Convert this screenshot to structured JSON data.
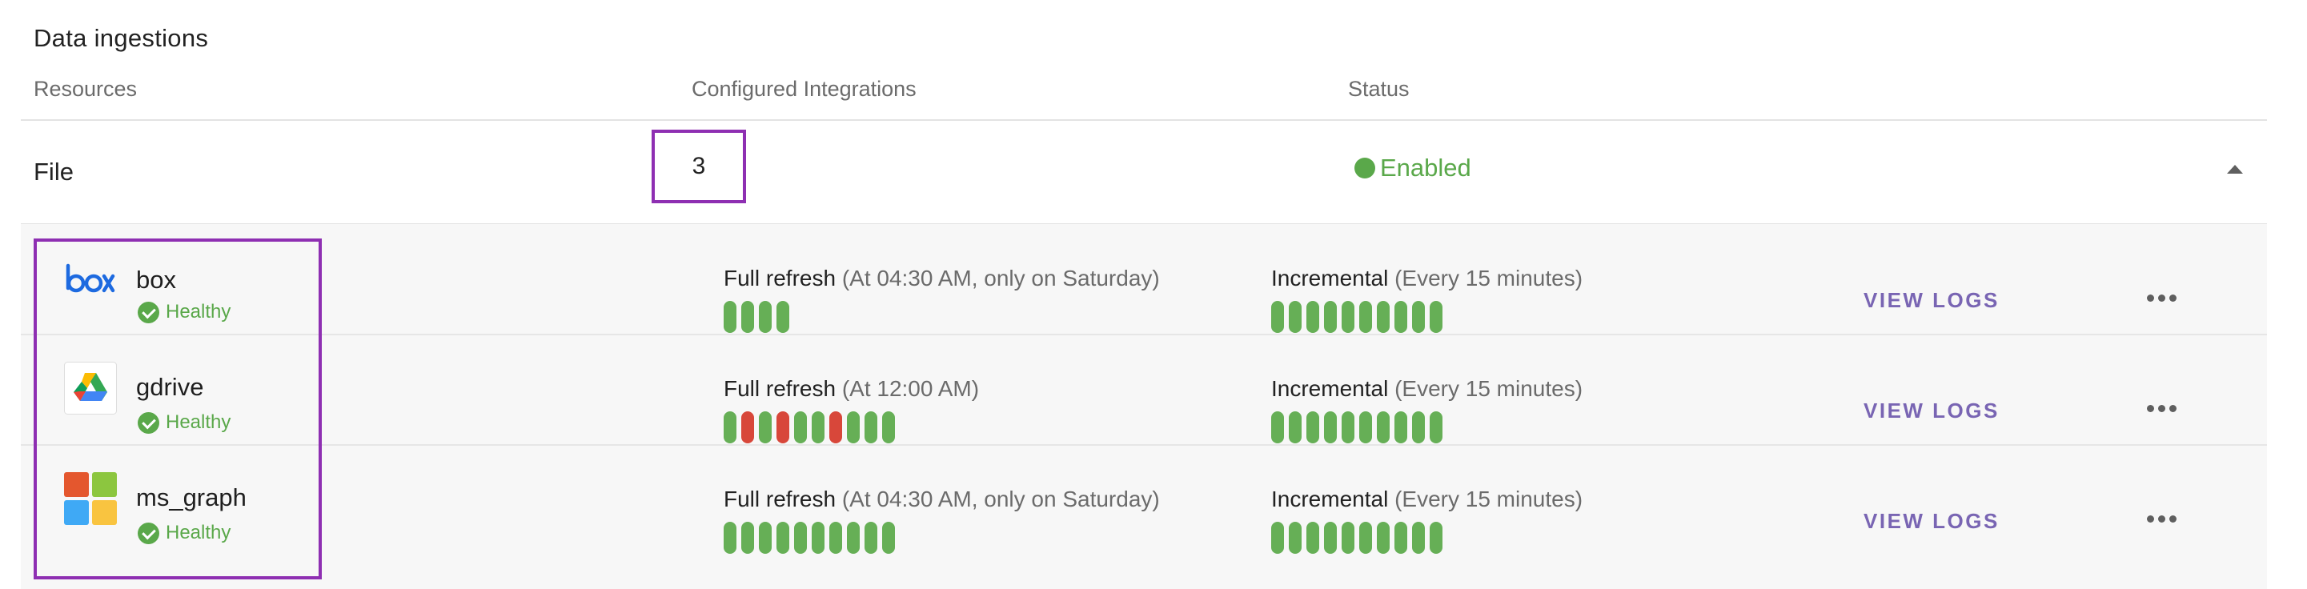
{
  "section": {
    "title": "Data ingestions"
  },
  "columns": {
    "resources": "Resources",
    "integrations": "Configured Integrations",
    "status": "Status"
  },
  "resource": {
    "name": "File",
    "integration_count": "3",
    "status_label": "Enabled",
    "status_color": "#5aa84a"
  },
  "integrations": [
    {
      "name": "box",
      "icon": "box-logo-icon",
      "health": "Healthy",
      "full_refresh_label": "Full refresh",
      "full_refresh_schedule": "(At 04:30 AM, only on Saturday)",
      "full_refresh_runs": [
        "success",
        "success",
        "success",
        "success"
      ],
      "incremental_label": "Incremental",
      "incremental_schedule": "(Every 15 minutes)",
      "incremental_runs": [
        "success",
        "success",
        "success",
        "success",
        "success",
        "success",
        "success",
        "success",
        "success",
        "success"
      ],
      "view_logs": "VIEW LOGS"
    },
    {
      "name": "gdrive",
      "icon": "google-drive-logo-icon",
      "health": "Healthy",
      "full_refresh_label": "Full refresh",
      "full_refresh_schedule": "(At 12:00 AM)",
      "full_refresh_runs": [
        "success",
        "fail",
        "success",
        "fail",
        "success",
        "success",
        "fail",
        "success",
        "success",
        "success"
      ],
      "incremental_label": "Incremental",
      "incremental_schedule": "(Every 15 minutes)",
      "incremental_runs": [
        "success",
        "success",
        "success",
        "success",
        "success",
        "success",
        "success",
        "success",
        "success",
        "success"
      ],
      "view_logs": "VIEW LOGS"
    },
    {
      "name": "ms_graph",
      "icon": "microsoft-logo-icon",
      "health": "Healthy",
      "full_refresh_label": "Full refresh",
      "full_refresh_schedule": "(At 04:30 AM, only on Saturday)",
      "full_refresh_runs": [
        "success",
        "success",
        "success",
        "success",
        "success",
        "success",
        "success",
        "success",
        "success",
        "success"
      ],
      "incremental_label": "Incremental",
      "incremental_schedule": "(Every 15 minutes)",
      "incremental_runs": [
        "success",
        "success",
        "success",
        "success",
        "success",
        "success",
        "success",
        "success",
        "success",
        "success"
      ],
      "view_logs": "VIEW LOGS"
    }
  ],
  "colors": {
    "success": "#66af56",
    "fail": "#d8473a",
    "highlight": "#8e2fb2",
    "link": "#7965b3"
  }
}
